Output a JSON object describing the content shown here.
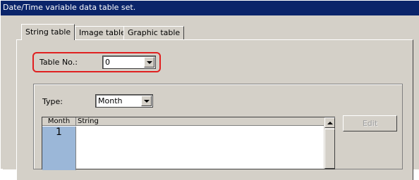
{
  "window": {
    "title": "Date/Time variable data table set."
  },
  "tabs": [
    {
      "label": "String table",
      "active": true
    },
    {
      "label": "Image table",
      "active": false
    },
    {
      "label": "Graphic table",
      "active": false
    }
  ],
  "table_no": {
    "label": "Table No.:",
    "value": "0"
  },
  "type": {
    "label": "Type:",
    "value": "Month"
  },
  "grid": {
    "headers": [
      "Month",
      "String"
    ],
    "rows": [
      {
        "month": "1",
        "string": ""
      }
    ]
  },
  "edit_button": {
    "label": "Edit",
    "enabled": false
  },
  "colors": {
    "title_bar": "#0a246a",
    "highlight": "#e02020",
    "selected_cell": "#9bb7d8"
  }
}
